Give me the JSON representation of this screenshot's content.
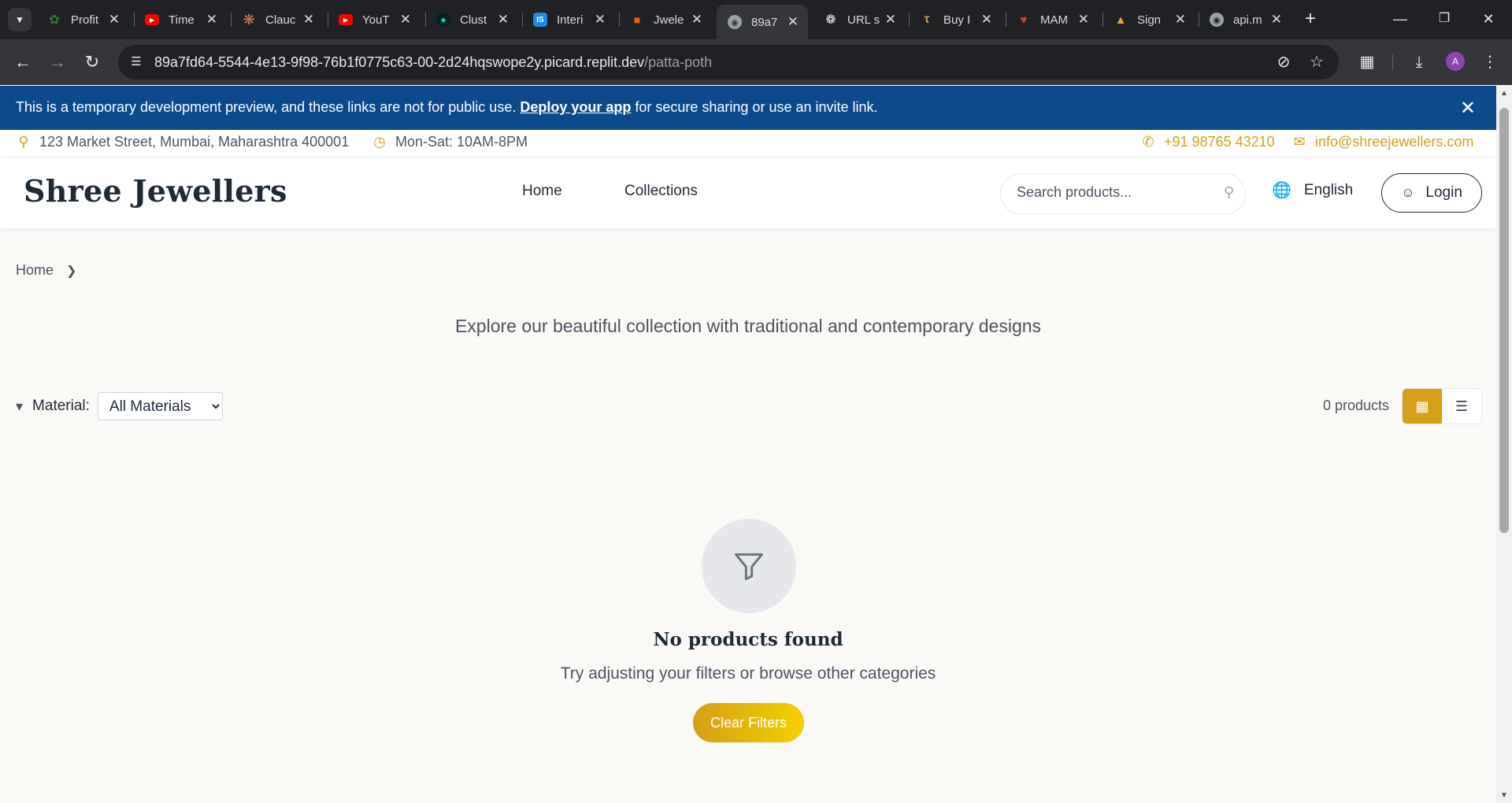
{
  "browser": {
    "tabs": [
      {
        "title": "Profit",
        "icon": "leaf-icon",
        "color": "#2e7d32"
      },
      {
        "title": "Time",
        "icon": "youtube-icon",
        "color": "#ff0000"
      },
      {
        "title": "Clauc",
        "icon": "claude-icon",
        "color": "#d97757"
      },
      {
        "title": "YouT",
        "icon": "youtube-icon",
        "color": "#ff0000"
      },
      {
        "title": "Clust",
        "icon": "mongodb-leaf-icon",
        "color": "#00a35c"
      },
      {
        "title": "Interi",
        "icon": "is-icon",
        "color": "#1e88e5"
      },
      {
        "title": "Jwele",
        "icon": "replit-icon",
        "color": "#f26207"
      },
      {
        "title": "89a7",
        "icon": "globe-icon",
        "color": "#9aa0a6"
      },
      {
        "title": "URL s",
        "icon": "openai-icon",
        "color": "#e8eaed"
      },
      {
        "title": "Buy I",
        "icon": "tanishq-icon",
        "color": "#c59d5f"
      },
      {
        "title": "MAM",
        "icon": "mam-icon",
        "color": "#b71c1c"
      },
      {
        "title": "Sign",
        "icon": "sign-icon",
        "color": "#e6a23c"
      },
      {
        "title": "api.m",
        "icon": "globe-icon",
        "color": "#9aa0a6"
      }
    ],
    "active_tab": 7,
    "url_host": "89a7fd64-5544-4e13-9f98-76b1f0775c63-00-2d24hqswope2y.picard.replit.dev",
    "url_path": "/patta-poth",
    "profile_initial": "A"
  },
  "banner": {
    "text_before": "This is a temporary development preview, and these links are not for public use. ",
    "link": "Deploy your app",
    "text_after": " for secure sharing or use an invite link."
  },
  "topinfo": {
    "address": "123 Market Street, Mumbai, Maharashtra 400001",
    "hours": "Mon-Sat: 10AM-8PM",
    "phone": "+91 98765 43210",
    "email": "info@shreejewellers.com"
  },
  "header": {
    "logo": "Shree Jewellers",
    "nav": [
      "Home",
      "Collections"
    ],
    "search_placeholder": "Search products...",
    "language": "English",
    "login": "Login"
  },
  "breadcrumb": {
    "home": "Home"
  },
  "main": {
    "subtitle": "Explore our beautiful collection with traditional and contemporary designs",
    "filter_label": "Material:",
    "material_selected": "All Materials",
    "count": "0 products",
    "view_mode": "grid"
  },
  "empty": {
    "title": "No products found",
    "text": "Try adjusting your filters or browse other categories",
    "button": "Clear Filters"
  },
  "colors": {
    "accent": "#d4a017",
    "banner": "#0d4a8c"
  }
}
